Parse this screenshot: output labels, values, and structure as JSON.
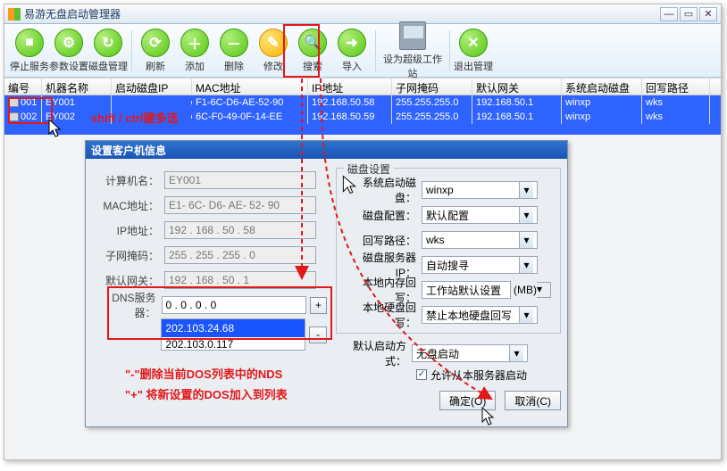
{
  "window": {
    "title": "易游无盘启动管理器"
  },
  "toolbar": {
    "stop": "停止服务",
    "params": "参数设置",
    "disk": "磁盘管理",
    "refresh": "刷新",
    "add": "添加",
    "del": "删除",
    "edit": "修改",
    "search": "搜索",
    "import": "导入",
    "super": "设为超级工作站",
    "exit": "退出管理"
  },
  "grid": {
    "headers": [
      "编号",
      "机器名称",
      "启动磁盘IP",
      "MAC地址",
      "IP地址",
      "子网掩码",
      "默认网关",
      "系统启动磁盘",
      "回写路径"
    ],
    "rows": [
      {
        "id": "001",
        "name": "EY001",
        "bootip": "",
        "mac": "F1-6C-D6-AE-52-90",
        "ip": "192.168.50.58",
        "mask": "255.255.255.0",
        "gw": "192.168.50.1",
        "boot": "winxp",
        "wpath": "wks"
      },
      {
        "id": "002",
        "name": "EY002",
        "bootip": "",
        "mac": "6C-F0-49-0F-14-EE",
        "ip": "192.168.50.59",
        "mask": "255.255.255.0",
        "gw": "192.168.50.1",
        "boot": "winxp",
        "wpath": "wks"
      }
    ]
  },
  "annot": {
    "shift": "shift / ctrl键多选",
    "minus": "\"-\"删除当前DOS列表中的NDS",
    "plus": "\"+\" 将新设置的DOS加入到列表"
  },
  "dialog": {
    "title": "设置客户机信息",
    "labels": {
      "pcname": "计算机名：",
      "mac": "MAC地址：",
      "ip": "IP地址：",
      "mask": "子网掩码：",
      "gw": "默认网关：",
      "dns": "DNS服务器："
    },
    "values": {
      "pcname": "EY001",
      "mac": "E1- 6C- D6- AE- 52- 90",
      "ip": "192  . 168  . 50   . 58",
      "mask": "255  . 255  . 255  . 0",
      "gw": "192  . 168  . 50   . 1",
      "dnsInput": "0     . 0    . 0    . 0"
    },
    "dnsList": [
      "202.103.24.68",
      "202.103.0.117"
    ],
    "btnPlus": "+",
    "btnMinus": "-",
    "group": {
      "caption": "磁盘设置",
      "labels": {
        "boot": "系统启动磁盘：",
        "cfg": "磁盘配置：",
        "wpath": "回写路径：",
        "srv": "磁盘服务器IP：",
        "mem": "本地内存回写：",
        "mb": "(MB)",
        "hdd": "本地硬盘回写："
      },
      "values": {
        "boot": "winxp",
        "cfg": "默认配置",
        "wpath": "wks",
        "srv": "自动搜寻",
        "mem": "工作站默认设置",
        "hdd": "禁止本地硬盘回写"
      }
    },
    "footer": {
      "modeLabel": "默认启动方式：",
      "modeValue": "无盘启动",
      "allow": "允许从本服务器启动",
      "ok": "确定(O)",
      "cancel": "取消(C)",
      "okKey": "O",
      "cancelKey": "C"
    }
  }
}
